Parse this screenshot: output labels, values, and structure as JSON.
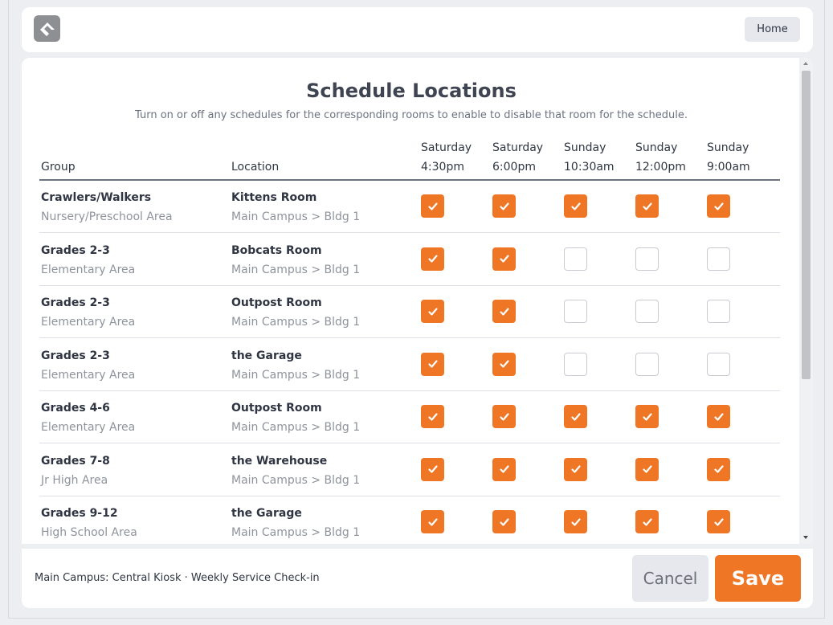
{
  "header": {
    "logo_icon": "rock-logo-icon",
    "home_label": "Home"
  },
  "page": {
    "title": "Schedule Locations",
    "subtitle": "Turn on or off any schedules for the corresponding rooms to enable to disable that room for the schedule."
  },
  "table": {
    "col_group": "Group",
    "col_location": "Location",
    "schedules": [
      {
        "day": "Saturday",
        "time": "4:30pm"
      },
      {
        "day": "Saturday",
        "time": "6:00pm"
      },
      {
        "day": "Sunday",
        "time": "10:30am"
      },
      {
        "day": "Sunday",
        "time": "12:00pm"
      },
      {
        "day": "Sunday",
        "time": "9:00am"
      }
    ],
    "rows": [
      {
        "group": "Crawlers/Walkers",
        "area": "Nursery/Preschool Area",
        "location": "Kittens Room",
        "path": "Main Campus > Bldg 1",
        "checks": [
          true,
          true,
          true,
          true,
          true
        ]
      },
      {
        "group": "Grades 2-3",
        "area": "Elementary Area",
        "location": "Bobcats Room",
        "path": "Main Campus > Bldg 1",
        "checks": [
          true,
          true,
          false,
          false,
          false
        ]
      },
      {
        "group": "Grades 2-3",
        "area": "Elementary Area",
        "location": "Outpost Room",
        "path": "Main Campus > Bldg 1",
        "checks": [
          true,
          true,
          false,
          false,
          false
        ]
      },
      {
        "group": "Grades 2-3",
        "area": "Elementary Area",
        "location": "the Garage",
        "path": "Main Campus > Bldg 1",
        "checks": [
          true,
          true,
          false,
          false,
          false
        ]
      },
      {
        "group": "Grades 4-6",
        "area": "Elementary Area",
        "location": "Outpost Room",
        "path": "Main Campus > Bldg 1",
        "checks": [
          true,
          true,
          true,
          true,
          true
        ]
      },
      {
        "group": "Grades 7-8",
        "area": "Jr High Area",
        "location": "the Warehouse",
        "path": "Main Campus > Bldg 1",
        "checks": [
          true,
          true,
          true,
          true,
          true
        ]
      },
      {
        "group": "Grades 9-12",
        "area": "High School Area",
        "location": "the Garage",
        "path": "Main Campus > Bldg 1",
        "checks": [
          true,
          true,
          true,
          true,
          true
        ]
      }
    ]
  },
  "footer": {
    "context": "Main Campus: Central Kiosk · Weekly Service Check-in",
    "cancel_label": "Cancel",
    "save_label": "Save"
  },
  "colors": {
    "accent": "#ee7625",
    "background": "#eceef2",
    "secondary_button": "#e6e8ee"
  }
}
